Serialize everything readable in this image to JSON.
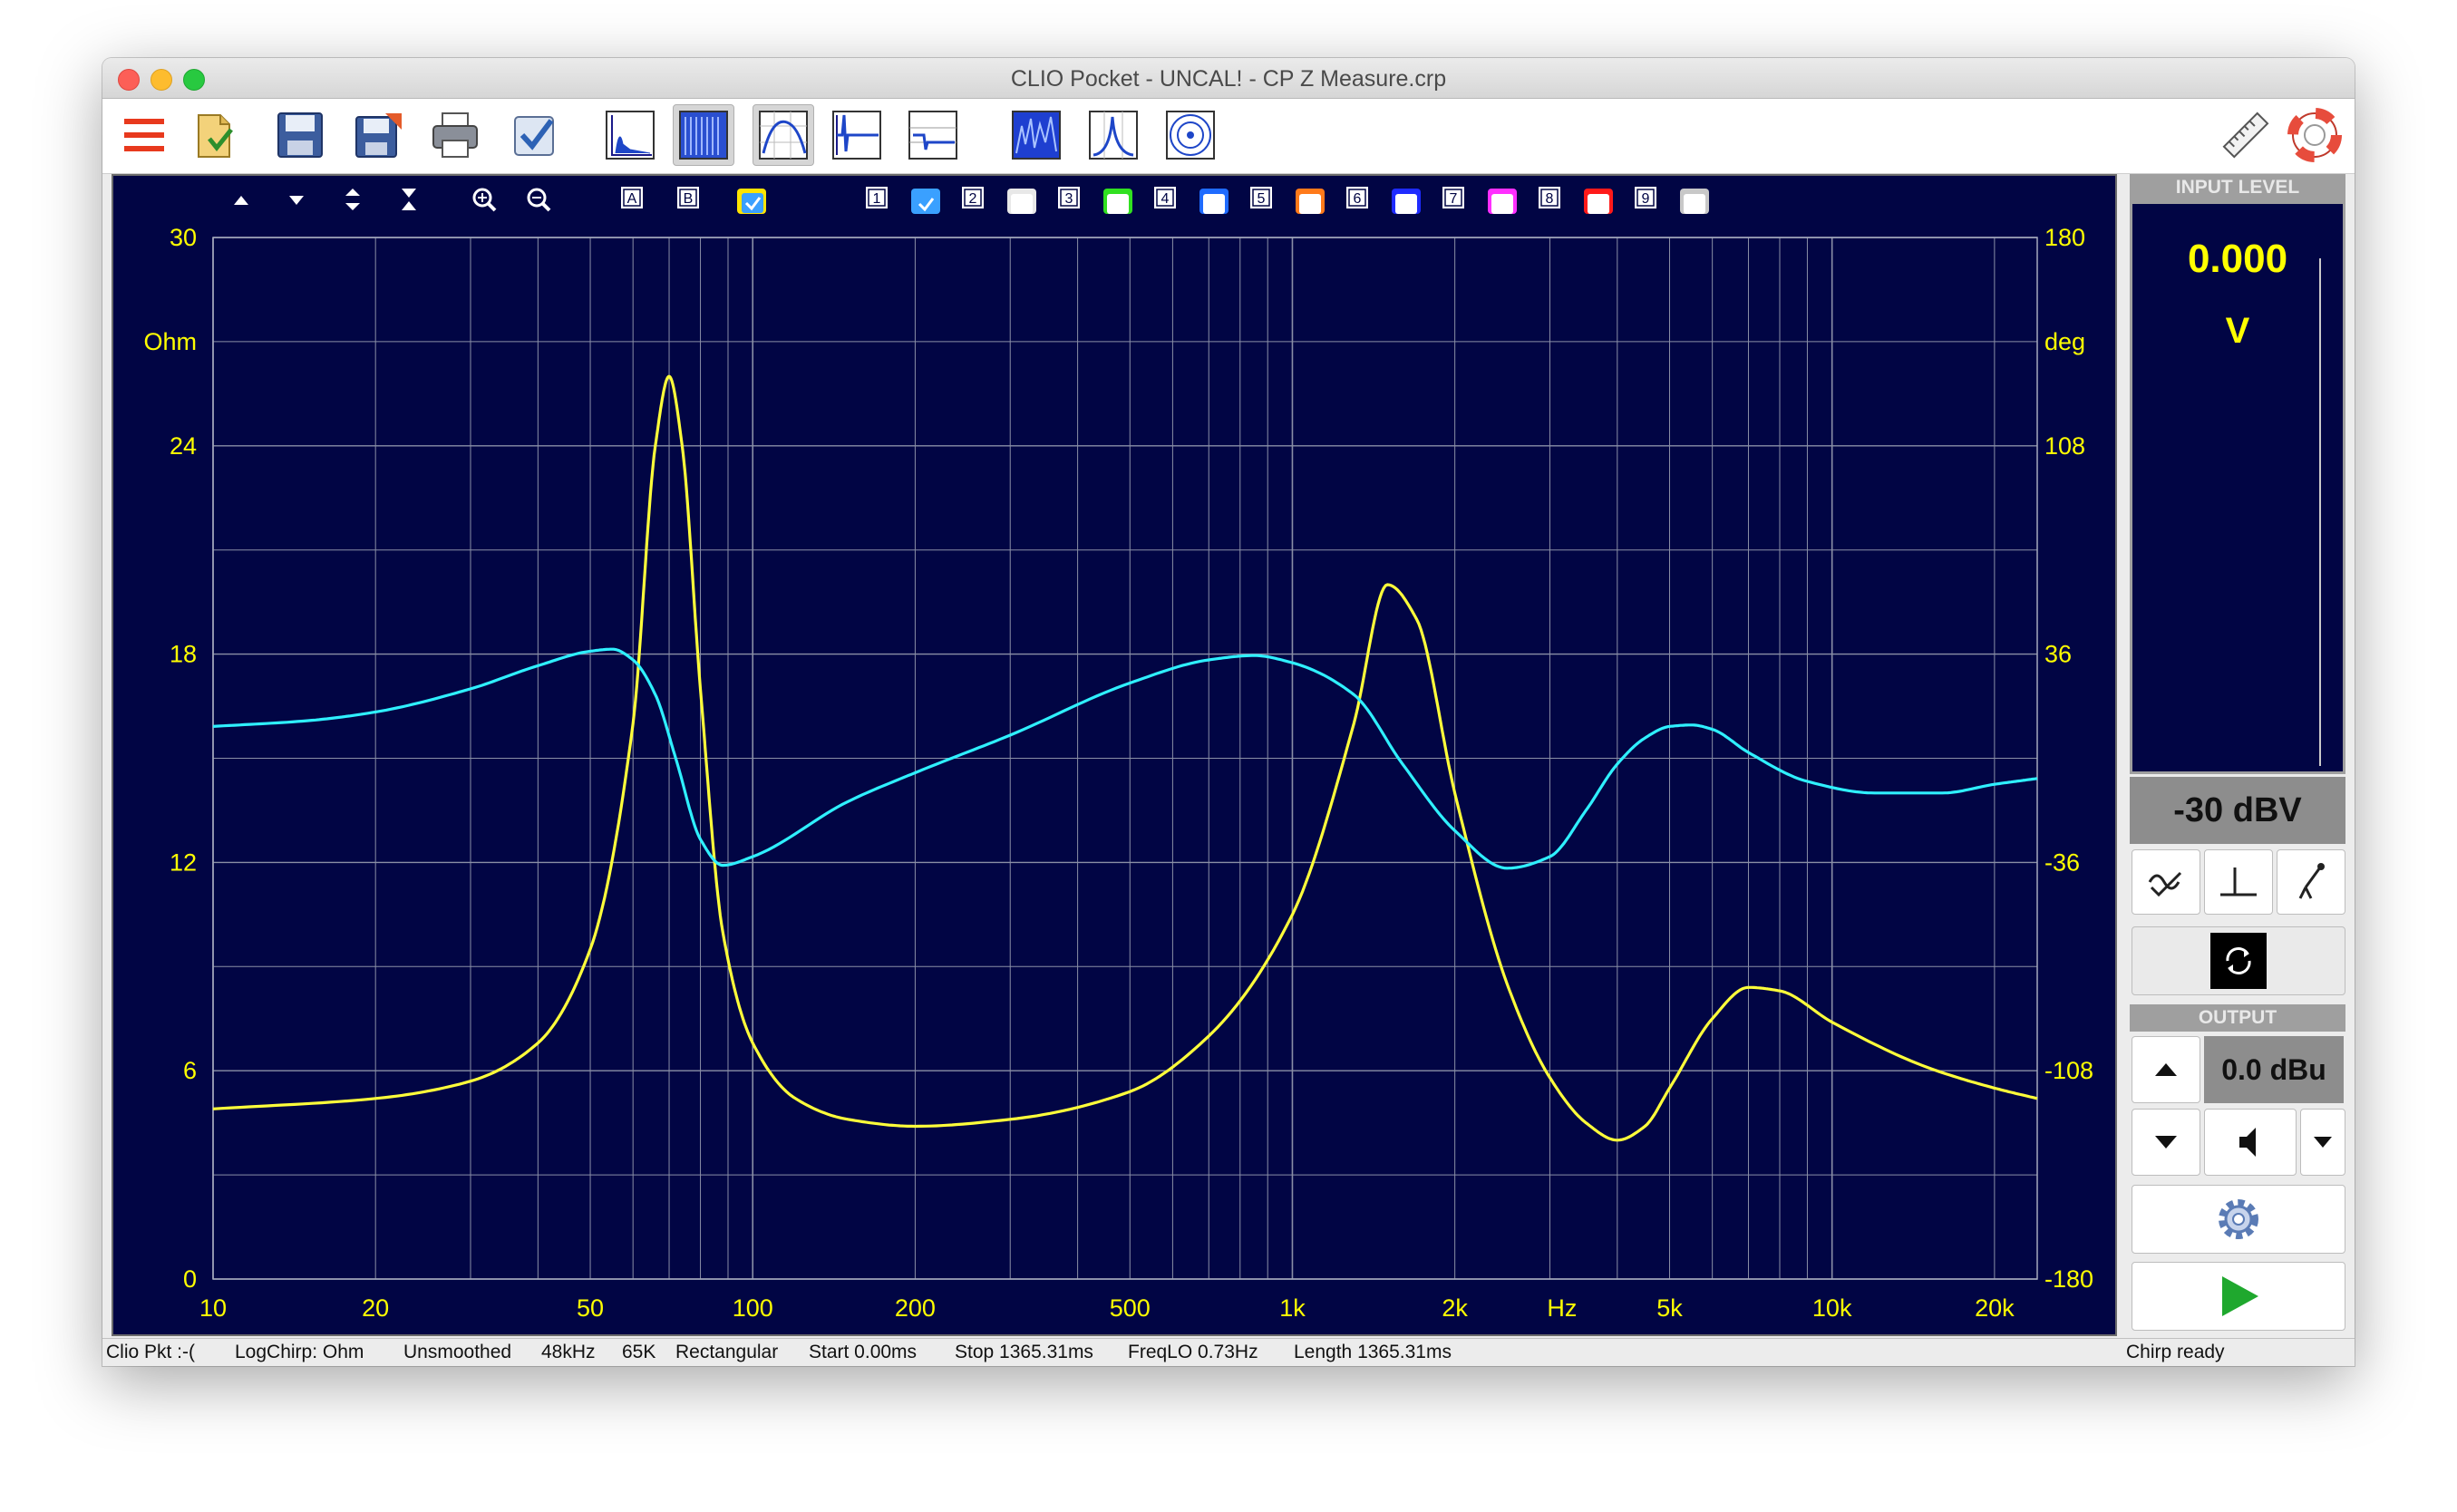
{
  "window": {
    "title": "CLIO Pocket - UNCAL! - CP Z Measure.crp"
  },
  "toolbar": {
    "buttons": [
      {
        "name": "menu-button",
        "icon": "hamburger-icon"
      },
      {
        "name": "open-button",
        "icon": "open-file-icon"
      },
      {
        "name": "save-button",
        "icon": "save-icon"
      },
      {
        "name": "save-as-button",
        "icon": "save-as-icon"
      },
      {
        "name": "print-button",
        "icon": "printer-icon"
      },
      {
        "name": "check-button",
        "icon": "checkbox-icon"
      },
      {
        "name": "fft-button",
        "icon": "fft-icon"
      },
      {
        "name": "rta-button",
        "icon": "rta-icon"
      },
      {
        "name": "sinusoidal-button",
        "icon": "frequency-response-icon"
      },
      {
        "name": "impulse-button",
        "icon": "impulse-icon"
      },
      {
        "name": "step-button",
        "icon": "step-icon"
      },
      {
        "name": "waterfall-button",
        "icon": "waterfall-icon"
      },
      {
        "name": "thd-button",
        "icon": "peak-icon"
      },
      {
        "name": "polar-button",
        "icon": "polar-icon"
      },
      {
        "name": "ruler-button",
        "icon": "ruler-icon"
      },
      {
        "name": "help-button",
        "icon": "lifebuoy-icon"
      }
    ]
  },
  "plot_toolbar": {
    "nav": [
      "up-arrow-icon",
      "down-arrow-icon",
      "expand-icon",
      "compress-icon",
      "zoom-in-icon",
      "zoom-out-icon"
    ],
    "cursor_a": "A",
    "cursor_b": "B",
    "overlays": [
      {
        "label": "1",
        "color": "#3aa0ff",
        "checked": true
      },
      {
        "label": "2",
        "color": "#e8e8e8",
        "checked": false
      },
      {
        "label": "3",
        "color": "#31e020",
        "checked": false
      },
      {
        "label": "4",
        "color": "#1f6bff",
        "checked": false
      },
      {
        "label": "5",
        "color": "#ff7a1a",
        "checked": false
      },
      {
        "label": "6",
        "color": "#1e2bff",
        "checked": false
      },
      {
        "label": "7",
        "color": "#ff2fff",
        "checked": false
      },
      {
        "label": "8",
        "color": "#ff1a1a",
        "checked": false
      },
      {
        "label": "9",
        "color": "#c8c8c8",
        "checked": false
      }
    ]
  },
  "chart_data": {
    "type": "line",
    "x_scale": "log",
    "xlim": [
      10,
      24000
    ],
    "x_ticks": [
      {
        "v": 10,
        "label": "10"
      },
      {
        "v": 20,
        "label": "20"
      },
      {
        "v": 50,
        "label": "50"
      },
      {
        "v": 100,
        "label": "100"
      },
      {
        "v": 200,
        "label": "200"
      },
      {
        "v": 500,
        "label": "500"
      },
      {
        "v": 1000,
        "label": "1k"
      },
      {
        "v": 2000,
        "label": "2k"
      },
      {
        "v": 5000,
        "label": "5k"
      },
      {
        "v": 10000,
        "label": "10k"
      },
      {
        "v": 20000,
        "label": "20k"
      }
    ],
    "x_unit_label": "Hz",
    "y_left": {
      "unit": "Ohm",
      "range": [
        0,
        30
      ],
      "ticks": [
        "0",
        "6",
        "12",
        "18",
        "24",
        "30"
      ]
    },
    "y_right": {
      "unit": "deg",
      "range": [
        -180,
        180
      ],
      "ticks": [
        "-180",
        "-108",
        "-36",
        "36",
        "108",
        "180"
      ]
    },
    "grid": true,
    "axis_color": "#ffff00",
    "grid_color": "#8a8fa6",
    "series": [
      {
        "color": "#ffff3a",
        "axis": "left",
        "points": [
          [
            10,
            4.9
          ],
          [
            20,
            5.2
          ],
          [
            30,
            5.7
          ],
          [
            40,
            6.8
          ],
          [
            50,
            9.5
          ],
          [
            60,
            16
          ],
          [
            66,
            24
          ],
          [
            70,
            26
          ],
          [
            74,
            24
          ],
          [
            80,
            17
          ],
          [
            88,
            10
          ],
          [
            100,
            6.8
          ],
          [
            120,
            5.2
          ],
          [
            150,
            4.6
          ],
          [
            200,
            4.4
          ],
          [
            300,
            4.6
          ],
          [
            500,
            5.4
          ],
          [
            700,
            7
          ],
          [
            1000,
            10.5
          ],
          [
            1300,
            16
          ],
          [
            1500,
            20
          ],
          [
            1700,
            19
          ],
          [
            2000,
            14
          ],
          [
            2500,
            8.5
          ],
          [
            3000,
            5.8
          ],
          [
            3500,
            4.5
          ],
          [
            4000,
            4.0
          ],
          [
            4500,
            4.4
          ],
          [
            5000,
            5.5
          ],
          [
            6000,
            7.5
          ],
          [
            7000,
            8.4
          ],
          [
            8000,
            8.3
          ],
          [
            10000,
            7.4
          ],
          [
            15000,
            6.1
          ],
          [
            20000,
            5.5
          ],
          [
            24000,
            5.2
          ]
        ]
      },
      {
        "color": "#2ff0ff",
        "axis": "right",
        "points": [
          [
            10,
            11
          ],
          [
            15,
            13
          ],
          [
            20,
            16
          ],
          [
            30,
            24
          ],
          [
            40,
            32
          ],
          [
            50,
            37
          ],
          [
            55,
            37.7
          ],
          [
            60,
            34
          ],
          [
            66,
            22
          ],
          [
            72,
            0
          ],
          [
            80,
            -28
          ],
          [
            88,
            -37
          ],
          [
            100,
            -34
          ],
          [
            150,
            -15
          ],
          [
            200,
            -5
          ],
          [
            300,
            8
          ],
          [
            500,
            26
          ],
          [
            700,
            34
          ],
          [
            850,
            35.5
          ],
          [
            1000,
            33
          ],
          [
            1300,
            22
          ],
          [
            1600,
            -2
          ],
          [
            2000,
            -25
          ],
          [
            2500,
            -38
          ],
          [
            3000,
            -34
          ],
          [
            3500,
            -18
          ],
          [
            4000,
            -2
          ],
          [
            4500,
            7
          ],
          [
            5000,
            11
          ],
          [
            5500,
            11.5
          ],
          [
            6000,
            10
          ],
          [
            7000,
            2
          ],
          [
            9000,
            -8
          ],
          [
            12000,
            -12
          ],
          [
            16000,
            -12
          ],
          [
            20000,
            -9
          ],
          [
            24000,
            -7
          ]
        ]
      }
    ]
  },
  "panel": {
    "input_level_label": "INPUT LEVEL",
    "input_value": "0.000",
    "input_unit": "V",
    "input_range": "-30 dBV",
    "output_label": "OUTPUT",
    "output_value": "0.0 dBu"
  },
  "statusbar": {
    "device": "Clio Pkt :-(",
    "mode": "LogChirp:  Ohm",
    "smoothing": "Unsmoothed",
    "rate": "48kHz",
    "size": "65K",
    "window": "Rectangular",
    "start": "Start 0.00ms",
    "stop": "Stop 1365.31ms",
    "freqlo": "FreqLO 0.73Hz",
    "length": "Length 1365.31ms",
    "state": "Chirp ready"
  }
}
